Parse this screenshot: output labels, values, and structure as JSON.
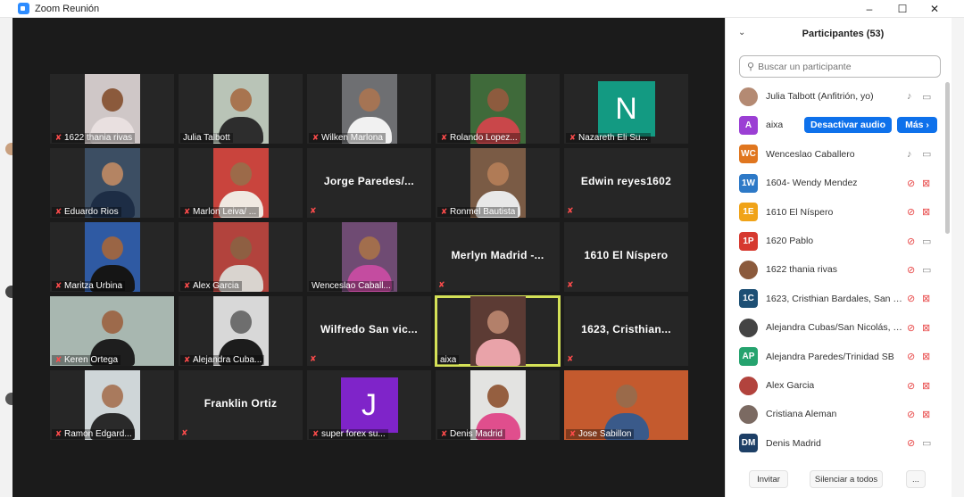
{
  "window": {
    "title": "Zoom Reunión",
    "controls": [
      "–",
      "☐",
      "✕"
    ]
  },
  "tiles": [
    {
      "name": "1622 thania rivas",
      "kind": "video",
      "muted": true,
      "bg": "#cfc7c7",
      "skin": "#8b5a3c",
      "shirt": "#e9e0e0"
    },
    {
      "name": "Julia Talbott",
      "kind": "video",
      "muted": false,
      "bg": "#b9c4b7",
      "skin": "#a8744f",
      "shirt": "#2d2d2d"
    },
    {
      "name": "Wilken Marlona",
      "kind": "video",
      "muted": true,
      "bg": "#6e6f72",
      "skin": "#a57454",
      "shirt": "#f1f1f1"
    },
    {
      "name": "Rolando Lopez...",
      "kind": "video",
      "muted": true,
      "bg": "#3f6a3a",
      "skin": "#8d5b3e",
      "shirt": "#c9474a"
    },
    {
      "name": "Nazareth Eli Su...",
      "kind": "letter",
      "letter": "N",
      "muted": true,
      "letterbg": "#139a82"
    },
    {
      "name": "Eduardo Rios",
      "kind": "video",
      "muted": true,
      "bg": "#3c4e63",
      "skin": "#b48463",
      "shirt": "#1d2d45"
    },
    {
      "name": "Marlon Leiva/ ...",
      "kind": "video",
      "muted": true,
      "bg": "#c9443d",
      "skin": "#9c6a49",
      "shirt": "#f0e9e1"
    },
    {
      "name": "Jorge Paredes/...",
      "kind": "name",
      "muted": true
    },
    {
      "name": "Ronmel Bautista",
      "kind": "video",
      "muted": true,
      "bg": "#7a5b45",
      "skin": "#b07b56",
      "shirt": "#e8e8e8"
    },
    {
      "name": "Edwin reyes1602",
      "kind": "name",
      "muted": true
    },
    {
      "name": "Maritza Urbina",
      "kind": "video",
      "muted": true,
      "bg": "#2f5aa3",
      "skin": "#9a6545",
      "shirt": "#151515"
    },
    {
      "name": "Alex Garcia",
      "kind": "video",
      "muted": true,
      "bg": "#b2433d",
      "skin": "#8e5f42",
      "shirt": "#d9d4cf"
    },
    {
      "name": "Wenceslao Caball...",
      "kind": "video",
      "muted": false,
      "bg": "#6f4b73",
      "skin": "#a26e4d",
      "shirt": "#c44ca0"
    },
    {
      "name": "Merlyn Madrid -...",
      "kind": "name",
      "muted": true
    },
    {
      "name": "1610 El Níspero",
      "kind": "name",
      "muted": true
    },
    {
      "name": "Keren Ortega",
      "kind": "video",
      "muted": true,
      "bg": "#a8b7b0",
      "skin": "#9d6a4b",
      "shirt": "#1e1e1e"
    },
    {
      "name": "Alejandra Cuba...",
      "kind": "video",
      "muted": true,
      "bg": "#d8d8d8",
      "skin": "#6e6e6e",
      "shirt": "#1c1c1c"
    },
    {
      "name": "Wilfredo San vic...",
      "kind": "name",
      "muted": true
    },
    {
      "name": "aixa",
      "kind": "video",
      "muted": false,
      "active": true,
      "bg": "#5c3b34",
      "skin": "#b3806a",
      "shirt": "#e9a3a9"
    },
    {
      "name": "1623, Cristhian...",
      "kind": "name",
      "muted": true
    },
    {
      "name": "Ramon Edgard...",
      "kind": "video",
      "muted": true,
      "bg": "#cfd6d8",
      "skin": "#a97a5d",
      "shirt": "#2a2a2a"
    },
    {
      "name": "Franklin Ortiz",
      "kind": "name",
      "muted": true
    },
    {
      "name": "super forex su...",
      "kind": "letter",
      "letter": "J",
      "muted": true,
      "letterbg": "#7f24c9"
    },
    {
      "name": "Denis Madrid",
      "kind": "video",
      "muted": true,
      "bg": "#e3e3e1",
      "skin": "#955f40",
      "shirt": "#e04e8d"
    },
    {
      "name": "Jose Sabillon",
      "kind": "video",
      "muted": true,
      "bg": "#c45a2e",
      "skin": "#9a6a4a",
      "shirt": "#3a5a8a"
    }
  ],
  "panel": {
    "collapse_icon": "chevron-down-icon",
    "title": "Participantes (53)",
    "search_placeholder": "Buscar un participante",
    "participants": [
      {
        "name": "Julia Talbott (Anfitrión, yo)",
        "avatar": "photo",
        "color": "#b48a73",
        "mic": "live",
        "cam": "live"
      },
      {
        "name": "aixa",
        "avatar": "A",
        "color": "#9b3fd4",
        "mic": "",
        "cam": "",
        "actions": [
          "Desactivar audio",
          "Más ›"
        ]
      },
      {
        "name": "Wenceslao Caballero",
        "avatar": "WC",
        "color": "#e0761f",
        "mic": "live",
        "cam": "live"
      },
      {
        "name": "1604- Wendy Mendez",
        "avatar": "1W",
        "color": "#2d79c7",
        "mic": "muted",
        "cam": "muted"
      },
      {
        "name": "1610 El Níspero",
        "avatar": "1E",
        "color": "#f0a318",
        "mic": "muted",
        "cam": "muted"
      },
      {
        "name": "1620 Pablo",
        "avatar": "1P",
        "color": "#d6392f",
        "mic": "muted",
        "cam": "live"
      },
      {
        "name": "1622 thania rivas",
        "avatar": "photo",
        "color": "#8b5a3c",
        "mic": "muted",
        "cam": "live"
      },
      {
        "name": "1623, Cristhian Bardales, San Pe...",
        "avatar": "1C",
        "color": "#1d4f74",
        "mic": "muted",
        "cam": "muted"
      },
      {
        "name": "Alejandra Cubas/San Nicolás, SB.",
        "avatar": "photo",
        "color": "#444444",
        "mic": "muted",
        "cam": "muted"
      },
      {
        "name": "Alejandra Paredes/Trinidad SB",
        "avatar": "AP",
        "color": "#25a36e",
        "mic": "muted",
        "cam": "muted"
      },
      {
        "name": "Alex Garcia",
        "avatar": "photo",
        "color": "#b2433d",
        "mic": "muted",
        "cam": "muted"
      },
      {
        "name": "Cristiana Aleman",
        "avatar": "photo",
        "color": "#7b6a62",
        "mic": "muted",
        "cam": "muted"
      },
      {
        "name": "Denis Madrid",
        "avatar": "DM",
        "color": "#1d3f66",
        "mic": "muted",
        "cam": "live"
      }
    ],
    "footer": {
      "invite": "Invitar",
      "mute_all": "Silenciar a todos",
      "more": "..."
    }
  }
}
